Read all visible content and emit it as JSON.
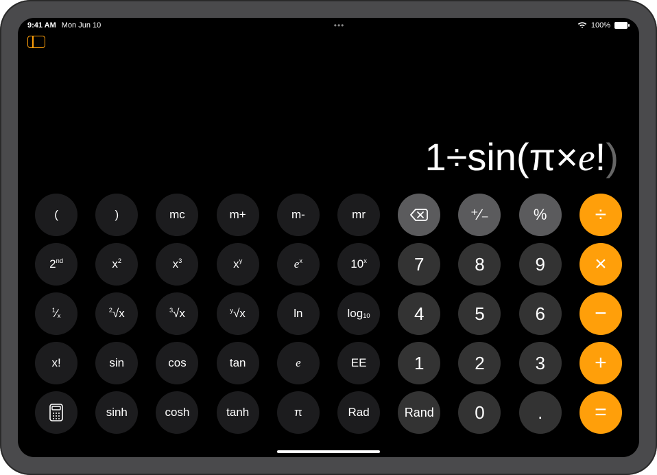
{
  "statusbar": {
    "time": "9:41 AM",
    "date": "Mon Jun 10",
    "battery": "100%"
  },
  "display": {
    "prefix": "1÷sin(π×",
    "e": "e",
    "bang": "!",
    "close": ")"
  },
  "buttons": {
    "lparen": "(",
    "rparen": ")",
    "mc": "mc",
    "mplus": "m+",
    "mminus": "m-",
    "mr": "mr",
    "plusminus": "⁺∕₋",
    "percent": "%",
    "divide": "÷",
    "second_base": "2",
    "second_sup": "nd",
    "x2_base": "x",
    "x2_sup": "2",
    "x3_base": "x",
    "x3_sup": "3",
    "xy_base": "x",
    "xy_sup": "y",
    "ex_base": "e",
    "ex_sup": "x",
    "tenx_base": "10",
    "tenx_sup": "x",
    "d7": "7",
    "d8": "8",
    "d9": "9",
    "multiply": "×",
    "invx_sup": "1",
    "invx_sym": "⁄",
    "invx_sub": "x",
    "root2_sup": "2",
    "root2_base": "√x",
    "root3_sup": "3",
    "root3_base": "√x",
    "rooty_sup": "y",
    "rooty_base": "√x",
    "ln": "ln",
    "log_base": "log",
    "log_sub": "10",
    "d4": "4",
    "d5": "5",
    "d6": "6",
    "minus": "−",
    "xfact": "x!",
    "sin": "sin",
    "cos": "cos",
    "tan": "tan",
    "e": "e",
    "ee": "EE",
    "d1": "1",
    "d2": "2",
    "d3": "3",
    "plus": "+",
    "sinh": "sinh",
    "cosh": "cosh",
    "tanh": "tanh",
    "pi": "π",
    "rad": "Rad",
    "rand": "Rand",
    "d0": "0",
    "dot": ".",
    "equals": "="
  }
}
